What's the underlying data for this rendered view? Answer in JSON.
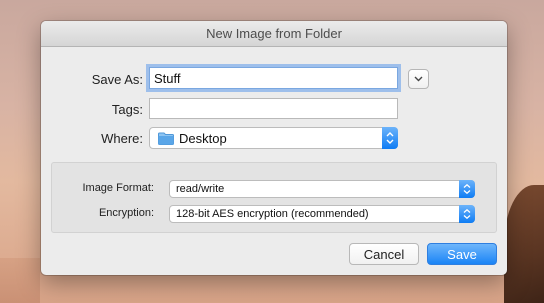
{
  "dialog": {
    "title": "New Image from Folder",
    "save_as_label": "Save As:",
    "save_as_value": "Stuff",
    "tags_label": "Tags:",
    "tags_value": "",
    "where_label": "Where:",
    "where_value": "Desktop",
    "where_icon": "folder-icon",
    "image_format_label": "Image Format:",
    "image_format_value": "read/write",
    "encryption_label": "Encryption:",
    "encryption_value": "128-bit AES encryption (recommended)",
    "cancel_label": "Cancel",
    "save_label": "Save"
  },
  "colors": {
    "accent": "#1a84f6",
    "focus_ring": "#5f9beb",
    "folder": "#5aa6e8"
  }
}
